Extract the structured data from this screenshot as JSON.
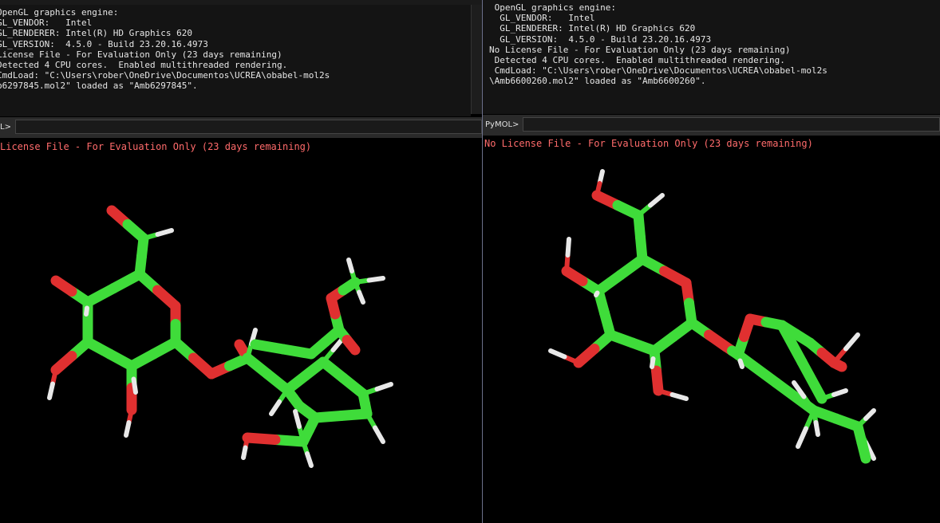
{
  "left": {
    "console_lines": [
      "OpenGL graphics engine:",
      "GL_VENDOR:   Intel",
      "GL_RENDERER: Intel(R) HD Graphics 620",
      "GL_VERSION:  4.5.0 - Build 23.20.16.4973",
      "License File - For Evaluation Only (23 days remaining)",
      "Detected 4 CPU cores.  Enabled multithreaded rendering.",
      "CmdLoad: \"C:\\Users\\rober\\OneDrive\\Documentos\\UCREA\\obabel-mol2s",
      "b6297845.mol2\" loaded as \"Amb6297845\"."
    ],
    "prompt": "L>",
    "input_value": "",
    "license_overlay": "License File - For Evaluation Only (23 days remaining)"
  },
  "right": {
    "console_lines": [
      " OpenGL graphics engine:",
      "  GL_VENDOR:   Intel",
      "  GL_RENDERER: Intel(R) HD Graphics 620",
      "  GL_VERSION:  4.5.0 - Build 23.20.16.4973",
      "No License File - For Evaluation Only (23 days remaining)",
      " Detected 4 CPU cores.  Enabled multithreaded rendering.",
      " CmdLoad: \"C:\\Users\\rober\\OneDrive\\Documentos\\UCREA\\obabel-mol2s",
      "\\Amb6600260.mol2\" loaded as \"Amb6600260\"."
    ],
    "prompt": "PyMOL>",
    "input_value": "",
    "license_overlay": "No License File - For Evaluation Only (23 days remaining)"
  },
  "colors": {
    "carbon": "#3fdc3a",
    "oxygen": "#e03030",
    "hydrogen": "#e8e8e8",
    "license_text": "#ff6b6b"
  }
}
